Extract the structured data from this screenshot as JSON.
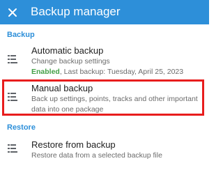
{
  "header": {
    "title": "Backup manager",
    "close_icon": "close-icon",
    "background": "#2d8fd9"
  },
  "sections": {
    "backup": "Backup",
    "restore": "Restore"
  },
  "items": {
    "automatic": {
      "title": "Automatic backup",
      "subtitle": "Change backup settings",
      "status": "Enabled",
      "last_backup": ", Last backup: Tuesday, April 25, 2023",
      "icon": "backup-list-icon"
    },
    "manual": {
      "title": "Manual backup",
      "subtitle": "Back up settings, points, tracks and other important data into one package",
      "icon": "backup-list-icon"
    },
    "restore": {
      "title": "Restore from backup",
      "subtitle": "Restore data from a selected backup file",
      "icon": "restore-list-icon"
    }
  },
  "colors": {
    "accent": "#2d8fd9",
    "enabled": "#43a047",
    "highlight": "#e81d1d"
  }
}
